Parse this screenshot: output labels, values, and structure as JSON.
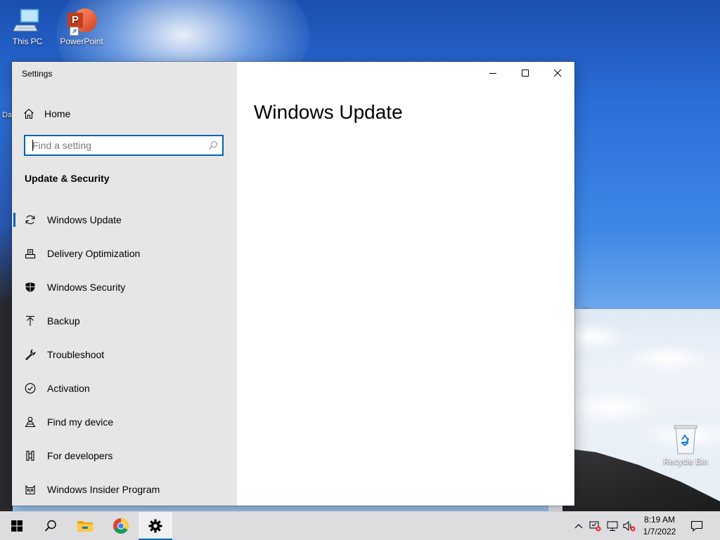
{
  "desktop": {
    "icons": [
      {
        "label": "This PC",
        "icon": "computer-icon"
      },
      {
        "label": "PowerPoint",
        "icon": "powerpoint-icon"
      },
      {
        "label": "Recycle Bin",
        "icon": "recycle-bin-icon"
      }
    ],
    "partial_label": "Da"
  },
  "window": {
    "title": "Settings",
    "controls": {
      "minimize": "minimize-icon",
      "maximize": "maximize-icon",
      "close": "close-icon"
    },
    "sidebar": {
      "home_label": "Home",
      "search": {
        "placeholder": "Find a setting",
        "value": ""
      },
      "section_title": "Update & Security",
      "items": [
        {
          "label": "Windows Update",
          "icon": "sync-icon",
          "selected": true
        },
        {
          "label": "Delivery Optimization",
          "icon": "delivery-optimization-icon"
        },
        {
          "label": "Windows Security",
          "icon": "shield-icon"
        },
        {
          "label": "Backup",
          "icon": "upload-arrow-icon"
        },
        {
          "label": "Troubleshoot",
          "icon": "wrench-icon"
        },
        {
          "label": "Activation",
          "icon": "check-circle-icon"
        },
        {
          "label": "Find my device",
          "icon": "person-location-icon"
        },
        {
          "label": "For developers",
          "icon": "developer-icon"
        },
        {
          "label": "Windows Insider Program",
          "icon": "insider-cat-icon"
        }
      ]
    },
    "main": {
      "title": "Windows Update"
    }
  },
  "taskbar": {
    "buttons": [
      {
        "name": "start",
        "icon": "windows-logo-icon"
      },
      {
        "name": "search",
        "icon": "search-icon"
      },
      {
        "name": "file-explorer",
        "icon": "folder-icon"
      },
      {
        "name": "chrome",
        "icon": "chrome-icon"
      },
      {
        "name": "settings",
        "icon": "gear-icon",
        "active": true
      }
    ],
    "tray": {
      "icons": [
        "chevron-up-icon",
        "security-alert-icon",
        "network-icon",
        "volume-muted-icon"
      ],
      "time": "8:19 AM",
      "date": "1/7/2022",
      "notification_icon": "notification-icon"
    }
  },
  "colors": {
    "accent": "#0063b1",
    "sidebar_bg": "#e6e6e6",
    "taskbar_bg": "#dddde0"
  }
}
